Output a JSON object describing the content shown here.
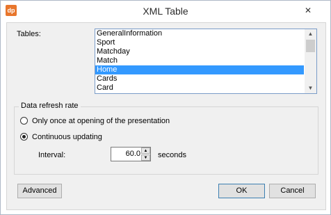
{
  "window": {
    "title": "XML Table",
    "app_icon_text": "dp",
    "close_glyph": "✕"
  },
  "tables": {
    "label": "Tables:",
    "items": [
      {
        "label": "GeneralInformation"
      },
      {
        "label": "Sport"
      },
      {
        "label": "Matchday"
      },
      {
        "label": "Match"
      },
      {
        "label": "Home",
        "selected": true
      },
      {
        "label": "Cards"
      },
      {
        "label": "Card"
      }
    ]
  },
  "refresh": {
    "group_title": "Data refresh rate",
    "option_once": "Only once at opening of the presentation",
    "option_continuous": "Continuous updating",
    "selected_option": "option_continuous",
    "interval_label": "Interval:",
    "interval_value": "60.0",
    "interval_unit": "seconds"
  },
  "buttons": {
    "advanced": "Advanced",
    "ok": "OK",
    "cancel": "Cancel"
  },
  "colors": {
    "selection": "#3399ff",
    "app_icon": "#e8762c"
  }
}
